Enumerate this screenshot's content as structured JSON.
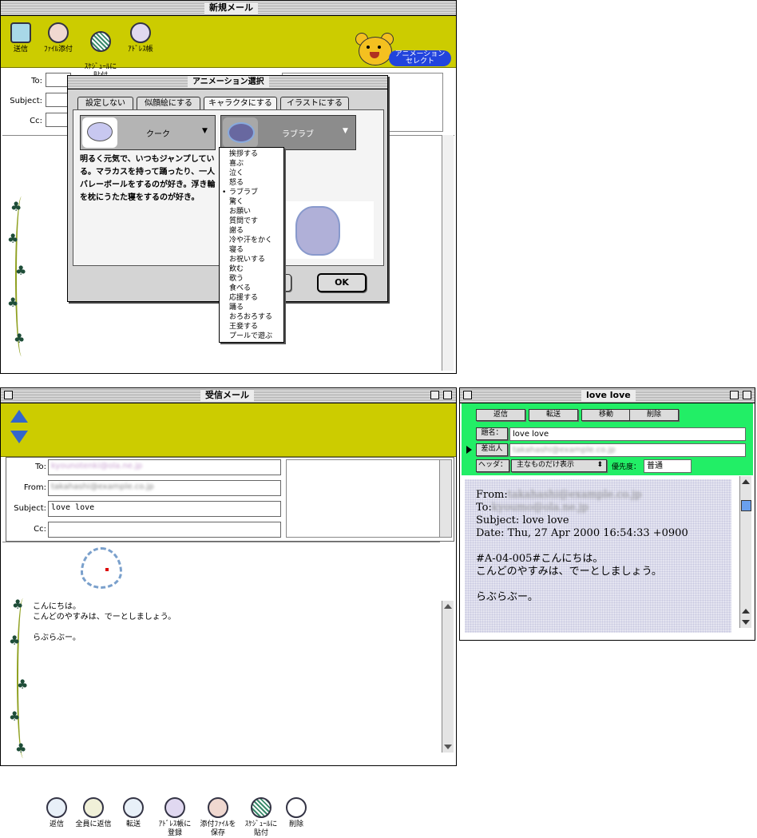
{
  "new_mail": {
    "title": "新規メール",
    "toolbar": [
      {
        "label": "送信",
        "icon": "send-icon"
      },
      {
        "label": "ﾌｧｲﾙ添付",
        "icon": "attach-file-icon"
      },
      {
        "label": "ｽｹｼﾞｭｰﾙに\n貼付",
        "icon": "schedule-paste-icon"
      },
      {
        "label": "ｱﾄﾞﾚｽ帳",
        "icon": "address-book-icon"
      }
    ],
    "animation_select_label": "アニメーション\nセレクト",
    "fields": {
      "to": "To:",
      "subject": "Subject:",
      "cc": "Cc:"
    }
  },
  "anim_dialog": {
    "title": "アニメーション選択",
    "tabs": [
      "設定しない",
      "似顔絵にする",
      "キャラクタにする",
      "イラストにする"
    ],
    "active_tab": 2,
    "character_select": "クーク",
    "animation_select": "ラブラブ",
    "description": "明るく元気で、いつもジャンプしている。マラカスを持って踊ったり、一人バレーボールをするのが好き。浮き輪を枕にうたた寝をするのが好き。",
    "ok_label": "OK",
    "menu_items": [
      "挨拶する",
      "喜ぶ",
      "泣く",
      "怒る",
      "ラブラブ",
      "驚く",
      "お願い",
      "質問です",
      "謝る",
      "冷や汗をかく",
      "寝る",
      "お祝いする",
      "飲む",
      "歌う",
      "食べる",
      "応援する",
      "踊る",
      "おろおろする",
      "王妾する",
      "プールで遊ぶ"
    ],
    "menu_checked": 4,
    "menu_check_mark": "•"
  },
  "received_mail": {
    "title": "受信メール",
    "toolbar": [
      {
        "label": "返信",
        "icon": "reply-icon"
      },
      {
        "label": "全員に返信",
        "icon": "reply-all-icon"
      },
      {
        "label": "転送",
        "icon": "forward-icon"
      },
      {
        "label": "ｱﾄﾞﾚｽ帳に\n登録",
        "icon": "add-address-icon"
      },
      {
        "label": "添付ﾌｧｲﾙを\n保存",
        "icon": "save-attachment-icon"
      },
      {
        "label": "ｽｹｼﾞｭｰﾙに\n貼付",
        "icon": "schedule-paste-icon"
      },
      {
        "label": "削除",
        "icon": "delete-icon"
      }
    ],
    "fields": {
      "to_label": "To:",
      "to_value": "kyounotenki@ola.ne.jp",
      "from_label": "From:",
      "from_value": "takahashi@example.co.jp",
      "subject_label": "Subject:",
      "subject_value": "love love",
      "cc_label": "Cc:",
      "cc_value": ""
    },
    "body": [
      "こんにちは。",
      "こんどのやすみは、でーとしましょう。",
      "",
      "らぶらぶー。"
    ]
  },
  "love_window": {
    "title": "love love",
    "buttons": [
      "返信",
      "転送",
      "移動",
      "削除"
    ],
    "subject_label": "題名：",
    "subject_value": "love love",
    "sender_label": "差出人",
    "sender_value": "takahashi@example.co.jp",
    "header_label": "ヘッダ：",
    "header_select": "主なものだけ表示",
    "priority_label": "優先度：",
    "priority_value": "普通",
    "headers": {
      "from_label": "From:",
      "from_value": "takahashi@example.co.jp",
      "to_label": "To:",
      "to_value": "kyoumo@ola.ne.jp",
      "subject": "Subject: love love",
      "date": "Date: Thu, 27 Apr 2000 16:54:33 +0900"
    },
    "body": [
      "#A-04-005#こんにちは。",
      "こんどのやすみは、でーとしましょう。",
      "",
      "らぶらぶー。"
    ]
  },
  "colors": {
    "toolbar_olive": "#cccc00",
    "love_green": "#22ee66",
    "dialog_gray": "#d4d4d4"
  }
}
